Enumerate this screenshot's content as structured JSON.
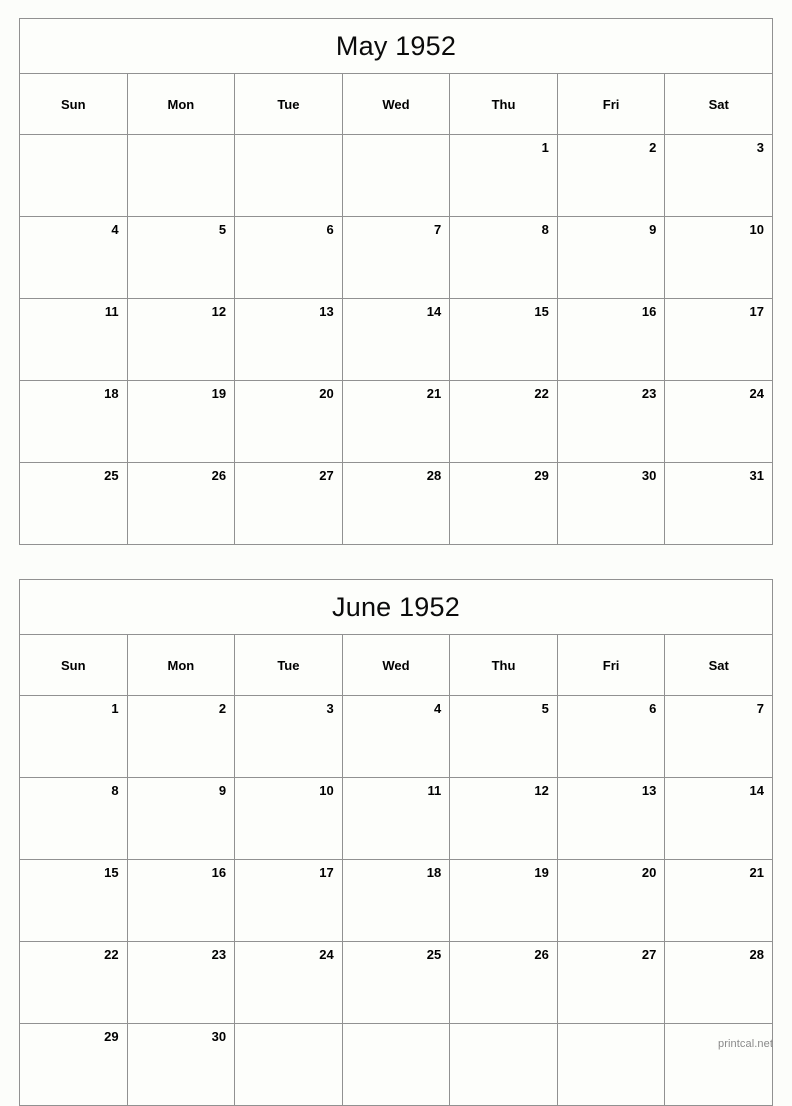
{
  "page": {
    "background_color": "#fcfdfa",
    "border_color": "#919191",
    "text_color": "#000000",
    "watermark": "printcal.net",
    "watermark_color": "#8a8a8a"
  },
  "calendars": [
    {
      "id": "may-1952",
      "title": "May 1952",
      "weekday_headers": [
        "Sun",
        "Mon",
        "Tue",
        "Wed",
        "Thu",
        "Fri",
        "Sat"
      ],
      "weeks": [
        [
          "",
          "",
          "",
          "",
          "1",
          "2",
          "3"
        ],
        [
          "4",
          "5",
          "6",
          "7",
          "8",
          "9",
          "10"
        ],
        [
          "11",
          "12",
          "13",
          "14",
          "15",
          "16",
          "17"
        ],
        [
          "18",
          "19",
          "20",
          "21",
          "22",
          "23",
          "24"
        ],
        [
          "25",
          "26",
          "27",
          "28",
          "29",
          "30",
          "31"
        ]
      ]
    },
    {
      "id": "june-1952",
      "title": "June 1952",
      "weekday_headers": [
        "Sun",
        "Mon",
        "Tue",
        "Wed",
        "Thu",
        "Fri",
        "Sat"
      ],
      "weeks": [
        [
          "1",
          "2",
          "3",
          "4",
          "5",
          "6",
          "7"
        ],
        [
          "8",
          "9",
          "10",
          "11",
          "12",
          "13",
          "14"
        ],
        [
          "15",
          "16",
          "17",
          "18",
          "19",
          "20",
          "21"
        ],
        [
          "22",
          "23",
          "24",
          "25",
          "26",
          "27",
          "28"
        ],
        [
          "29",
          "30",
          "",
          "",
          "",
          "",
          ""
        ]
      ]
    }
  ]
}
